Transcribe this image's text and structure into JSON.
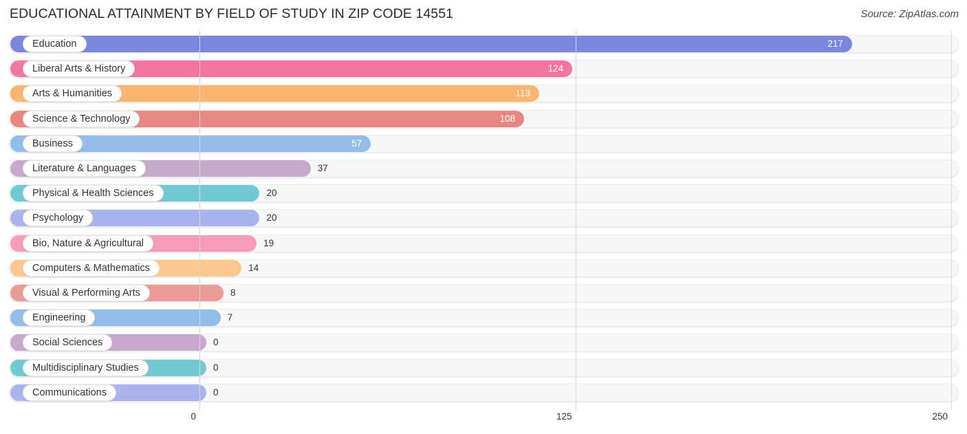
{
  "header": {
    "title": "EDUCATIONAL ATTAINMENT BY FIELD OF STUDY IN ZIP CODE 14551",
    "source": "Source: ZipAtlas.com"
  },
  "chart_data": {
    "type": "bar",
    "orientation": "horizontal",
    "title": "EDUCATIONAL ATTAINMENT BY FIELD OF STUDY IN ZIP CODE 14551",
    "xlabel": "",
    "ylabel": "",
    "xlim": [
      0,
      250
    ],
    "xticks": [
      0,
      125,
      250
    ],
    "xtick_labels": [
      "0",
      "125",
      "250"
    ],
    "grid": true,
    "legend": false,
    "categories": [
      "Education",
      "Liberal Arts & History",
      "Arts & Humanities",
      "Science & Technology",
      "Business",
      "Literature & Languages",
      "Physical & Health Sciences",
      "Psychology",
      "Bio, Nature & Agricultural",
      "Computers & Mathematics",
      "Visual & Performing Arts",
      "Engineering",
      "Social Sciences",
      "Multidisciplinary Studies",
      "Communications"
    ],
    "values": [
      217,
      124,
      113,
      108,
      57,
      37,
      20,
      20,
      19,
      14,
      8,
      7,
      0,
      0,
      0
    ],
    "value_labels": [
      "217",
      "124",
      "113",
      "108",
      "57",
      "37",
      "20",
      "20",
      "19",
      "14",
      "8",
      "7",
      "0",
      "0",
      "0"
    ],
    "colors": [
      "#7b86de",
      "#f4769f",
      "#fbb56e",
      "#e8877f",
      "#93bce8",
      "#c9a8cd",
      "#6fcbd0",
      "#aab4ec",
      "#f79cb8",
      "#fbc78e",
      "#eb9a95",
      "#93bce8",
      "#c9a8cd",
      "#6fcbd0",
      "#aab4ec"
    ]
  }
}
